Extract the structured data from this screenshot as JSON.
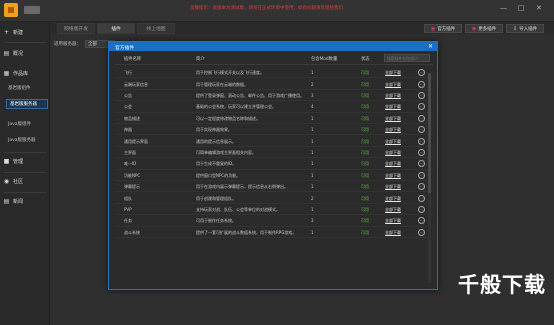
{
  "topbar": {
    "notice": "温馨提示：此版本为测试版，请勿在正式环境中使用，如有问题请反馈给我们",
    "minimize": "—",
    "maximize": "□",
    "close": "✕"
  },
  "sidebar": {
    "items": [
      {
        "label": "新建",
        "icon": "plus-icon"
      },
      {
        "label": "概况",
        "icon": "overview-icon"
      },
      {
        "label": "作品库",
        "icon": "library-icon"
      },
      {
        "label": "管理",
        "icon": "manage-icon"
      },
      {
        "label": "社区",
        "icon": "community-icon"
      },
      {
        "label": "新闻",
        "icon": "news-icon"
      }
    ],
    "subitems": [
      {
        "label": "基岩版组件"
      },
      {
        "label": "基岩版服务器"
      },
      {
        "label": "Java版组件"
      },
      {
        "label": "Java版服务器"
      }
    ]
  },
  "tabs": [
    "网络版开发",
    "插件",
    "线上地图"
  ],
  "toolbar": {
    "official_plugins": "官方插件",
    "more_plugins": "更多插件",
    "import_plugins": "导入插件"
  },
  "filter": {
    "label": "适用服务器：",
    "value": "全部"
  },
  "modal": {
    "title": "官方插件",
    "close": "✕",
    "headers": {
      "name": "插件名称",
      "desc": "简介",
      "count": "包含Mod数量",
      "status": "状态"
    },
    "search_placeholder": "搜索插件名称/简介",
    "rows": [
      {
        "name": "飞行",
        "desc": "用于控制飞行模式开关以及飞行速度。",
        "count": "1",
        "status": "可用",
        "download": "全部下载"
      },
      {
        "name": "云端玩家信息",
        "desc": "用于管理玩家在云端的数据。",
        "count": "2",
        "status": "可用",
        "download": "全部下载"
      },
      {
        "name": "公告",
        "desc": "提供了登录弹窗、滚动公告、邮件公告、用于游戏广播使用。",
        "count": "3",
        "status": "可用",
        "download": "全部下载"
      },
      {
        "name": "公会",
        "desc": "基础的公会系统，玩家可以建立并管理公会。",
        "count": "4",
        "status": "可用",
        "download": "全部下载"
      },
      {
        "name": "物品描述",
        "desc": "可以一定程度修改物品名称和描述。",
        "count": "1",
        "status": "可用",
        "download": "全部下载"
      },
      {
        "name": "神器",
        "desc": "用于实现神器效果。",
        "count": "1",
        "status": "可用",
        "download": "全部下载"
      },
      {
        "name": "通用提示界面",
        "desc": "通用的提示信息展示。",
        "count": "1",
        "status": "可用",
        "download": "全部下载"
      },
      {
        "name": "主界面",
        "desc": "可简单编辑游戏主界面相关内容。",
        "count": "1",
        "status": "可用",
        "download": "全部下载"
      },
      {
        "name": "唯一ID",
        "desc": "用于生成不重复的ID。",
        "count": "1",
        "status": "可用",
        "download": "全部下载"
      },
      {
        "name": "功能NPC",
        "desc": "提供窗口型NPC的功能。",
        "count": "1",
        "status": "可用",
        "download": "全部下载"
      },
      {
        "name": "弹幕提示",
        "desc": "用于在游戏内展示弹幕提示，提示信息从右侧弹出。",
        "count": "1",
        "status": "可用",
        "download": "全部下载"
      },
      {
        "name": "组队",
        "desc": "用于创建和管理组队。",
        "count": "2",
        "status": "可用",
        "download": "全部下载"
      },
      {
        "name": "PVP",
        "desc": "支持玩家对战、队伍、公会等单位的对战模式。",
        "count": "1",
        "status": "可用",
        "download": "全部下载"
      },
      {
        "name": "任务",
        "desc": "可用于制作任务系统。",
        "count": "3",
        "status": "可用",
        "download": "全部下载"
      },
      {
        "name": "战斗系统",
        "desc": "提供了一套可扩展的战斗数值系统，用于制作RPG游戏。",
        "count": "1",
        "status": "可用",
        "download": "全部下载"
      }
    ]
  },
  "watermark": "千般下载",
  "colors": {
    "accent": "#1a6fc4",
    "status_ok": "#5fbf4a",
    "notice": "#e23b3b"
  }
}
